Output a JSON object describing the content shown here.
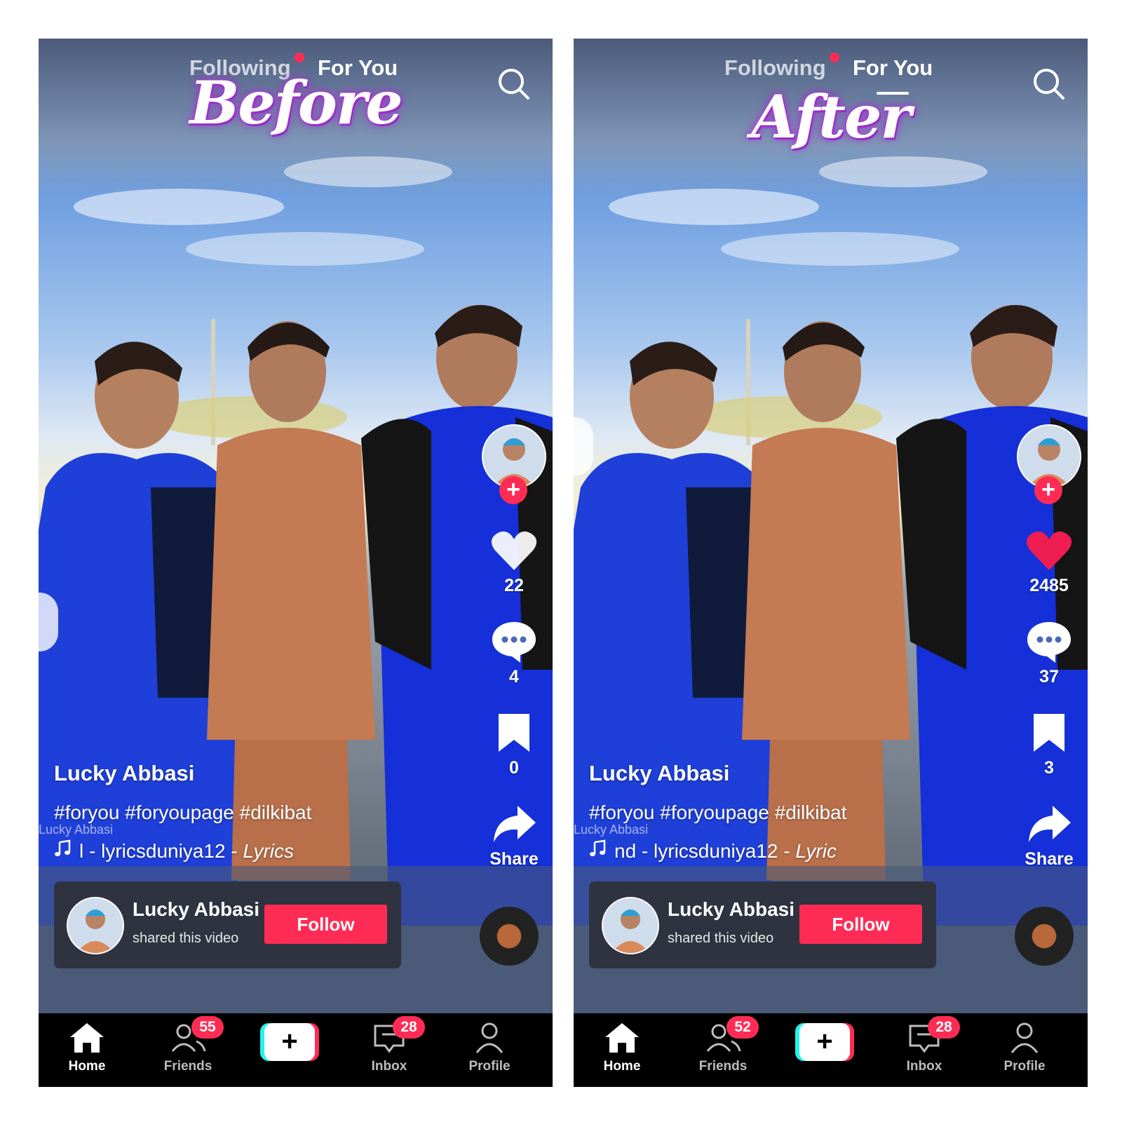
{
  "tabs": {
    "following": "Following",
    "for_you": "For You"
  },
  "colors": {
    "accent": "#fe2c55",
    "heart_liked": "#ee1d52",
    "nav_bg": "#000000",
    "card_bg": "#2f3340"
  },
  "icons": {
    "search": "search-icon",
    "heart": "heart-icon",
    "comment": "comment-icon",
    "bookmark": "bookmark-icon",
    "share": "share-icon",
    "home": "home-icon",
    "friends": "friends-icon",
    "create": "plus-icon",
    "inbox": "inbox-icon",
    "profile": "profile-icon",
    "music": "music-note-icon"
  },
  "before": {
    "overlay_label": "Before",
    "likes": "22",
    "comments": "4",
    "saves": "0",
    "share_label": "Share",
    "author": "Lucky Abbasi",
    "hashtags": "#foryou #foryoupage #dilkibat",
    "watermark": "Lucky Abbasi",
    "music_prefix": "l - lyricsduniya12 - ",
    "music_title": "Lyrics",
    "card": {
      "name": "Lucky Abbasi",
      "subtitle": "shared this video",
      "follow_label": "Follow"
    },
    "nav": {
      "home": "Home",
      "friends": "Friends",
      "friends_badge": "55",
      "inbox": "Inbox",
      "inbox_badge": "28",
      "profile": "Profile"
    }
  },
  "after": {
    "overlay_label": "After",
    "likes": "2485",
    "comments": "37",
    "saves": "3",
    "share_label": "Share",
    "author": "Lucky Abbasi",
    "hashtags": "#foryou #foryoupage #dilkibat",
    "watermark": "Lucky Abbasi",
    "music_prefix": "nd - lyricsduniya12 - ",
    "music_title": "Lyric",
    "card": {
      "name": "Lucky Abbasi",
      "subtitle": "shared this video",
      "follow_label": "Follow"
    },
    "nav": {
      "home": "Home",
      "friends": "Friends",
      "friends_badge": "52",
      "inbox": "Inbox",
      "inbox_badge": "28",
      "profile": "Profile"
    }
  }
}
